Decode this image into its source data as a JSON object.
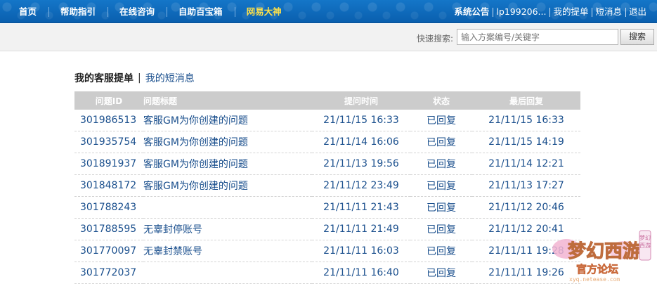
{
  "nav": {
    "left": [
      "首页",
      "帮助指引",
      "在线咨询",
      "自助百宝箱",
      "网易大神"
    ],
    "right": [
      "系统公告",
      "lp199206...",
      "我的提单",
      "短消息",
      "退出"
    ]
  },
  "search": {
    "label": "快速搜索:",
    "placeholder": "输入方案编号/关键字",
    "button": "搜索"
  },
  "tabs": {
    "active": "我的客服提单",
    "separator": "|",
    "other": "我的短消息"
  },
  "table": {
    "headers": [
      "问题ID",
      "问题标题",
      "提问时间",
      "状态",
      "最后回复"
    ],
    "rows": [
      {
        "id": "301986513",
        "title": "客服GM为你创建的问题",
        "asked": "21/11/15 16:33",
        "status": "已回复",
        "last": "21/11/15 16:33"
      },
      {
        "id": "301935754",
        "title": "客服GM为你创建的问题",
        "asked": "21/11/14 16:06",
        "status": "已回复",
        "last": "21/11/15 14:19"
      },
      {
        "id": "301891937",
        "title": "客服GM为你创建的问题",
        "asked": "21/11/13 19:56",
        "status": "已回复",
        "last": "21/11/14 12:21"
      },
      {
        "id": "301848172",
        "title": "客服GM为你创建的问题",
        "asked": "21/11/12 23:49",
        "status": "已回复",
        "last": "21/11/13 17:27"
      },
      {
        "id": "301788243",
        "title": "",
        "asked": "21/11/11 21:43",
        "status": "已回复",
        "last": "21/11/12 20:46"
      },
      {
        "id": "301788595",
        "title": "无辜封停账号",
        "asked": "21/11/11 21:49",
        "status": "已回复",
        "last": "21/11/12 20:41"
      },
      {
        "id": "301770097",
        "title": "无辜封禁账号",
        "asked": "21/11/11 16:03",
        "status": "已回复",
        "last": "21/11/11 19:28"
      },
      {
        "id": "301772037",
        "title": "",
        "asked": "21/11/11 16:40",
        "status": "已回复",
        "last": "21/11/11 19:26"
      }
    ]
  },
  "watermark": {
    "main": "梦幻西游",
    "sub": "官方论坛",
    "url": "xyq.netease.com",
    "tag": "梦幻西游"
  },
  "colors": {
    "nav_bg": "#0a66b8",
    "nav_highlight": "#ffe14a",
    "link": "#1a4f8d",
    "header_bg": "#cccccc"
  }
}
